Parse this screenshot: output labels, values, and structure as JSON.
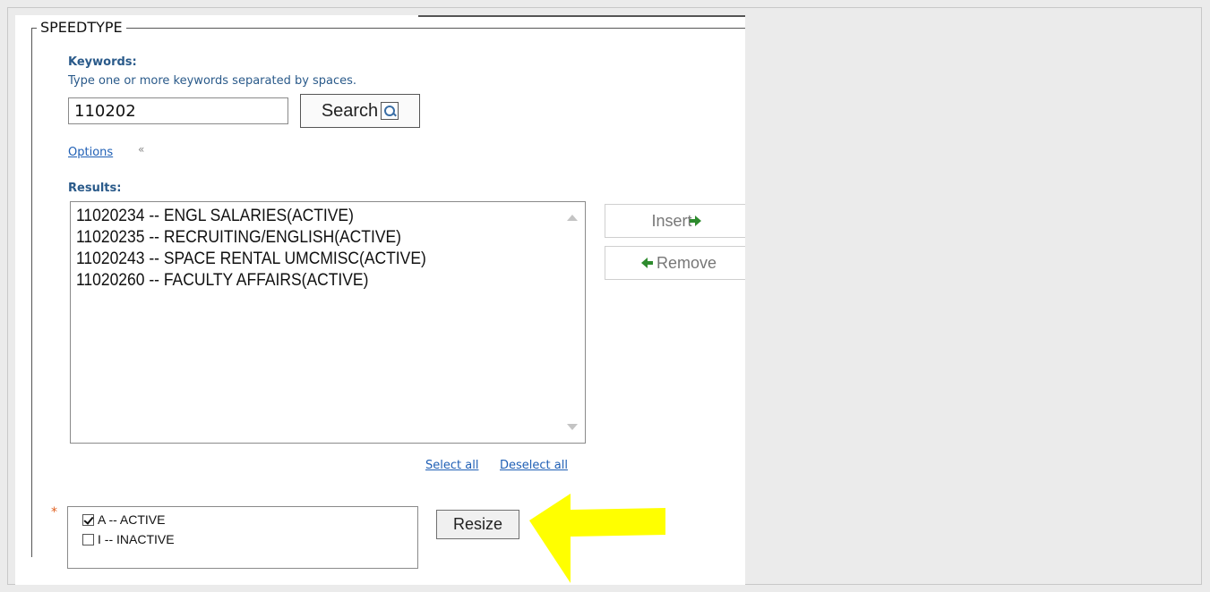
{
  "speedtype": {
    "legend": "SPEEDTYPE",
    "keywords_label": "Keywords:",
    "keywords_hint": "Type one or more keywords separated by spaces.",
    "keywords_value": "110202",
    "search_label": "Search",
    "options_label": "Options",
    "results_label": "Results:",
    "results": [
      "11020234 -- ENGL SALARIES(ACTIVE)",
      "11020235 -- RECRUITING/ENGLISH(ACTIVE)",
      "11020243 -- SPACE RENTAL UMCMISC(ACTIVE)",
      "11020260 -- FACULTY AFFAIRS(ACTIVE)"
    ],
    "insert_label": "Insert",
    "remove_label": "Remove",
    "select_all_label": "Select all",
    "deselect_all_label": "Deselect all",
    "required_marker": "*",
    "status_options": [
      {
        "label": "A -- ACTIVE",
        "checked": true
      },
      {
        "label": "I -- INACTIVE",
        "checked": false
      }
    ],
    "resize_label": "Resize"
  },
  "colors": {
    "label_blue": "#2a5a8a",
    "link_blue": "#1f5fb5",
    "required_orange": "#e06020",
    "annotation_yellow": "#ffff00",
    "arrow_green": "#2e8b2e"
  }
}
